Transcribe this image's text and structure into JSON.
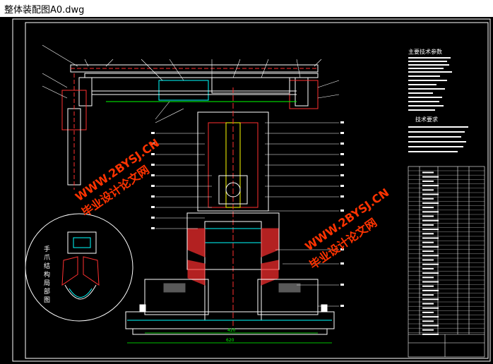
{
  "window": {
    "title": "整体装配图A0.dwg"
  },
  "drawing": {
    "detail_label": [
      "手",
      "爪",
      "结",
      "构",
      "局",
      "部",
      "图"
    ],
    "tech_params_title": "主要技术参数",
    "tech_req_title": "技术要求",
    "watermark_cn": "毕业设计论文网",
    "watermark_url": "WWW.2BYSJ.CN",
    "dim_main": "420",
    "dim_overall": "620",
    "colors": {
      "bg": "#000000",
      "frame": "#ffffff",
      "cyan": "#00ffff",
      "red": "#ff3030",
      "yellow": "#ffff00",
      "green": "#00ff00",
      "watermark": "#ff3300"
    }
  }
}
